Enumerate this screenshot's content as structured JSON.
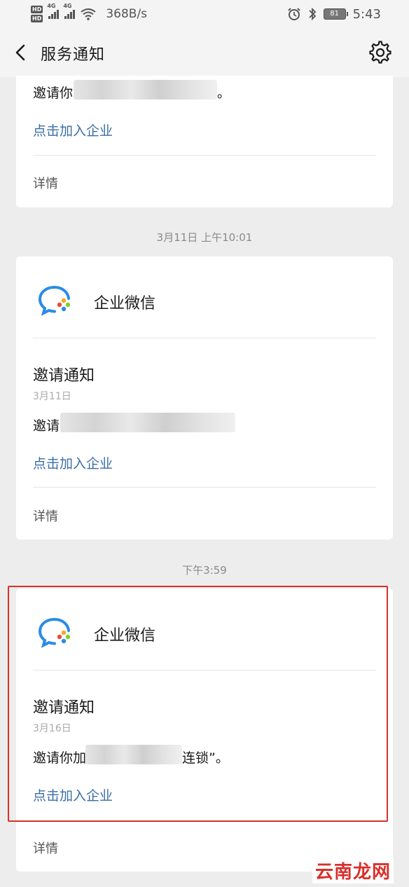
{
  "status_bar": {
    "hd1": "HD",
    "hd2": "HD",
    "net1": "4G",
    "net2": "4G",
    "speed": "368B/s",
    "battery": "81",
    "time": "5:43"
  },
  "header": {
    "title": "服务通知"
  },
  "card_top": {
    "body_text": "邀请你",
    "body_suffix": "。",
    "link": "点击加入企业",
    "detail": "详情"
  },
  "timestamp_1": "3月11日 上午10:01",
  "card_mid": {
    "sender": "企业微信",
    "title": "邀请通知",
    "date": "3月11日",
    "body_text": "邀请",
    "link": "点击加入企业",
    "detail": "详情"
  },
  "timestamp_2": "下午3:59",
  "card_bottom": {
    "sender": "企业微信",
    "title": "邀请通知",
    "date": "3月16日",
    "body_text": "邀请你加",
    "body_suffix": "连锁”。",
    "link": "点击加入企业",
    "detail": "详情"
  },
  "watermark": "云南龙网",
  "colors": {
    "background": "#ededed",
    "card": "#ffffff",
    "link": "#3b6ea5",
    "highlight": "#d9302b",
    "wecom_blue": "#2a8be8"
  },
  "icons": [
    "back-arrow-icon",
    "gear-icon",
    "wecom-logo-icon",
    "wifi-icon",
    "alarm-icon",
    "bluetooth-icon",
    "battery-icon"
  ]
}
